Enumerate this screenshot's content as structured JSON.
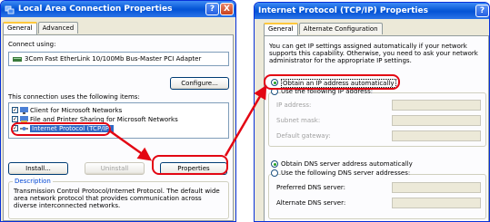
{
  "left_window": {
    "title": "Local Area Connection Properties",
    "help_label": "?",
    "close_label": "X",
    "tabs": [
      "General",
      "Advanced"
    ],
    "connect_using_label": "Connect using:",
    "adapter_name": "3Com Fast EtherLink 10/100Mb Bus-Master PCI Adapter",
    "configure_label": "Configure...",
    "items_label": "This connection uses the following items:",
    "items": [
      {
        "label": "Client for Microsoft Networks",
        "checked": true,
        "icon": "network-client-icon"
      },
      {
        "label": "File and Printer Sharing for Microsoft Networks",
        "checked": true,
        "icon": "file-printer-sharing-icon"
      },
      {
        "label": "Internet Protocol (TCP/IP)",
        "checked": true,
        "icon": "protocol-icon",
        "selected": true
      }
    ],
    "install_label": "Install...",
    "uninstall_label": "Uninstall",
    "properties_label": "Properties",
    "description_title": "Description",
    "description_text": "Transmission Control Protocol/Internet Protocol. The default wide area network protocol that provides communication across diverse interconnected networks."
  },
  "right_window": {
    "title": "Internet Protocol (TCP/IP) Properties",
    "help_label": "?",
    "tabs": [
      "General",
      "Alternate Configuration"
    ],
    "intro_text": "You can get IP settings assigned automatically if your network supports this capability. Otherwise, you need to ask your network administrator for the appropriate IP settings.",
    "obtain_ip_label": "Obtain an IP address automatically",
    "use_ip_label": "Use the following IP address:",
    "ip_address_label": "IP address:",
    "subnet_mask_label": "Subnet mask:",
    "default_gateway_label": "Default gateway:",
    "obtain_dns_label": "Obtain DNS server address automatically",
    "use_dns_label": "Use the following DNS server addresses:",
    "preferred_dns_label": "Preferred DNS server:",
    "alternate_dns_label": "Alternate DNS server:"
  },
  "colors": {
    "titlebar": "#0553d6",
    "dialog_bg": "#ece9d8",
    "highlight": "#e30613",
    "selection": "#316ac5"
  }
}
